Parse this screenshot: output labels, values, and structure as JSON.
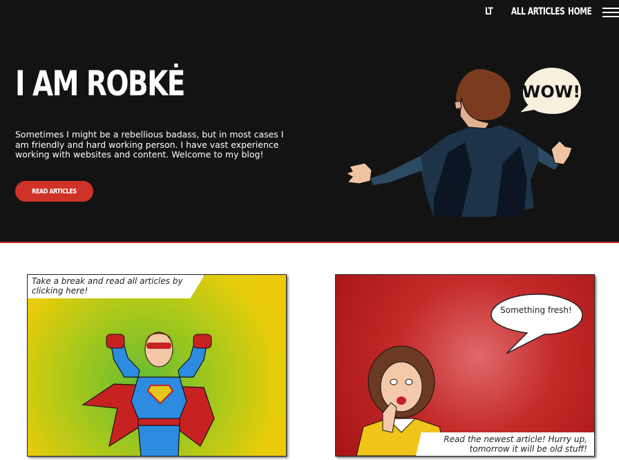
{
  "nav": {
    "items": [
      "LT",
      "ALL ARTICLES",
      "HOME"
    ]
  },
  "hero": {
    "title": "I AM ROBKĖ",
    "intro": "Sometimes I might be a rebellious badass, but in most cases I am friendly and hard working person. I have vast experience working with websites and content. Welcome to my blog!",
    "button_label": "READ ARTICLES",
    "speech": "WOW!"
  },
  "cards": [
    {
      "caption": "Take a break and read all articles by clicking here!"
    },
    {
      "caption": "Read the newest article! Hurry up, tomorrow it will be old stuff!",
      "bubble": "Something fresh!"
    }
  ],
  "colors": {
    "hero_bg": "#131313",
    "accent": "#cf3228"
  }
}
